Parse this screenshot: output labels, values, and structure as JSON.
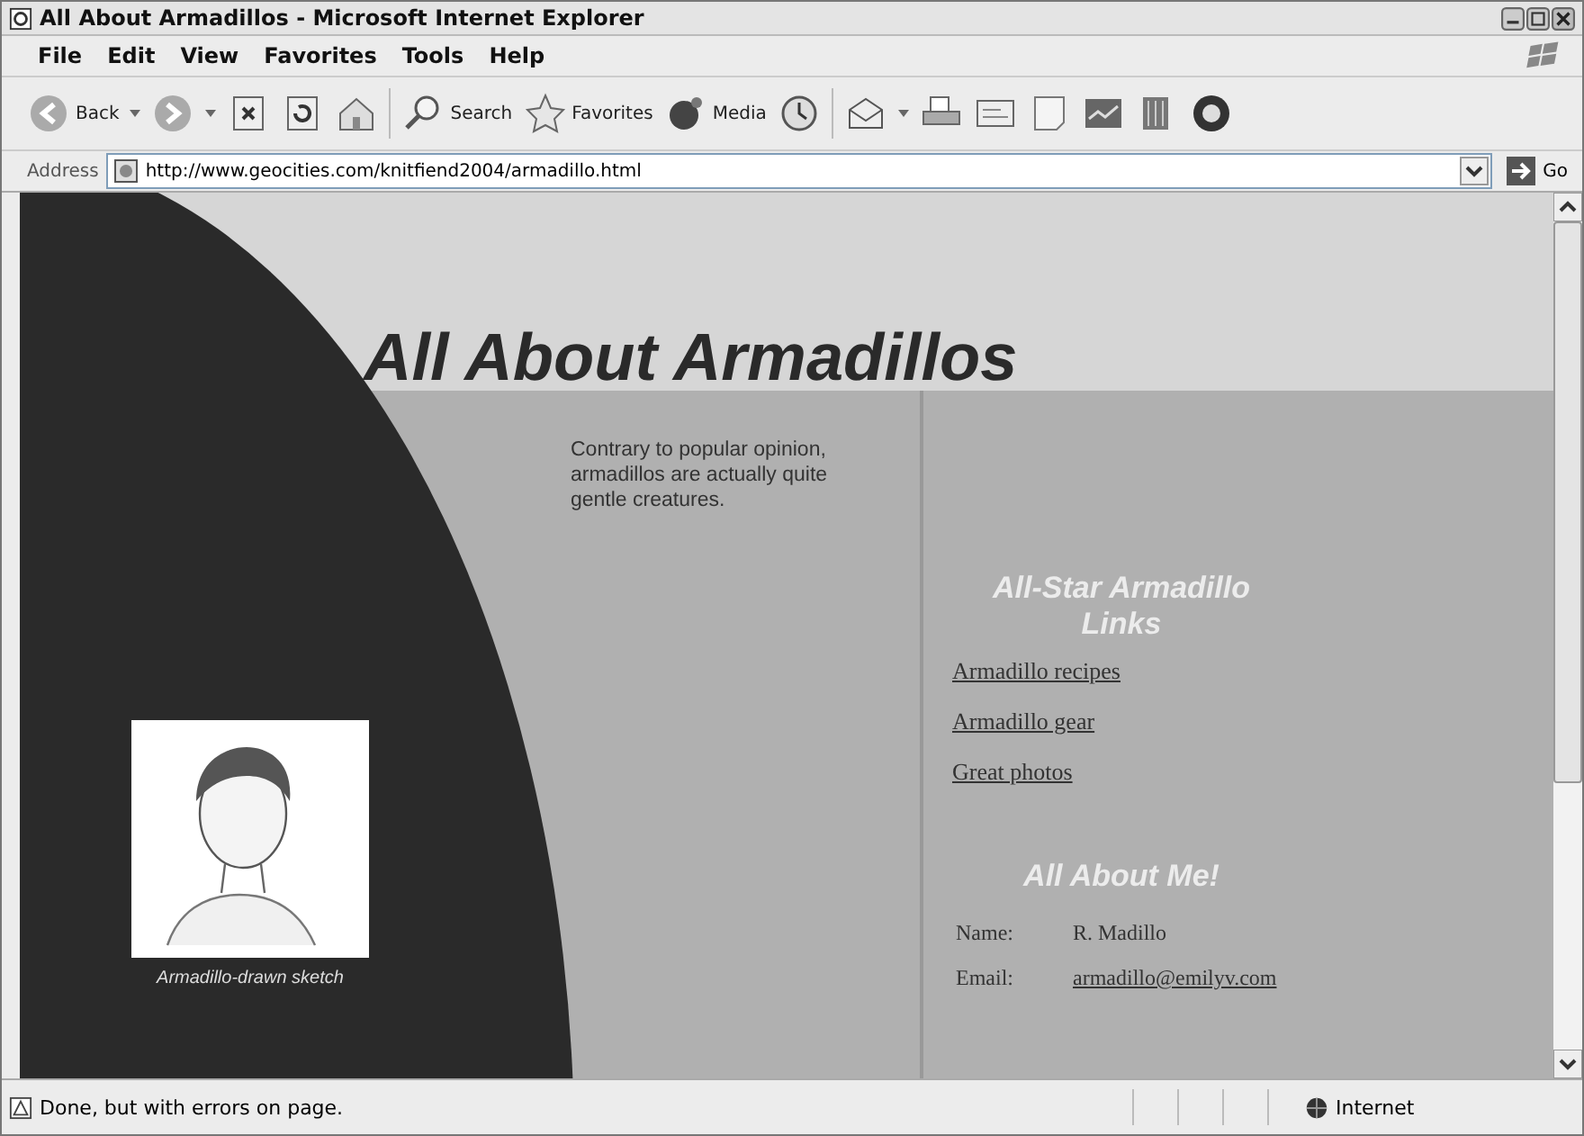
{
  "window": {
    "title": "All About Armadillos - Microsoft Internet Explorer"
  },
  "menu": [
    "File",
    "Edit",
    "View",
    "Favorites",
    "Tools",
    "Help"
  ],
  "toolbar": [
    {
      "label": "Back",
      "dropdown": true
    },
    {
      "dropdown": true
    },
    {
      "dropdown": false
    },
    {
      "dropdown": false
    },
    {
      "dropdown": false
    },
    {
      "label": "Search",
      "dropdown": false
    },
    {
      "label": "Favorites",
      "dropdown": false
    },
    {
      "label": "Media",
      "dropdown": false
    },
    {
      "dropdown": false
    },
    {
      "dropdown": true
    },
    {
      "dropdown": false
    },
    {
      "dropdown": false
    },
    {
      "dropdown": false
    },
    {
      "dropdown": false
    },
    {
      "dropdown": false
    },
    {
      "dropdown": false
    }
  ],
  "address": {
    "label": "Address",
    "url": "http://www.geocities.com/knitfiend2004/armadillo.html",
    "go": "Go"
  },
  "page": {
    "title": "All About Armadillos",
    "intro": "Contrary to popular opinion, armadillos are actually quite gentle creatures.",
    "caption": "Armadillo-drawn sketch",
    "links_heading": "All-Star Armadillo Links",
    "links": [
      "Armadillo recipes",
      "Armadillo gear",
      "Great photos"
    ],
    "about_heading": "All About Me!",
    "about": [
      {
        "label": "Name:",
        "value": "R. Madillo",
        "kind": "text"
      },
      {
        "label": "Email:",
        "value": "armadillo@emilyv.com",
        "kind": "link"
      }
    ]
  },
  "status_bar": {
    "text": "Done, but with errors on page.",
    "zone": "Internet"
  }
}
